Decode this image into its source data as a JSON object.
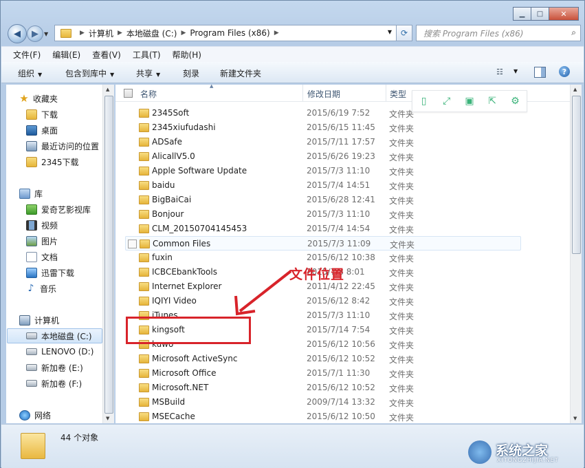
{
  "window": {
    "minimize": "▁",
    "maximize": "□",
    "close": "✕"
  },
  "address": {
    "crumbs": [
      "计算机",
      "本地磁盘 (C:)",
      "Program Files (x86)"
    ],
    "search_placeholder": "搜索 Program Files (x86)"
  },
  "menu": [
    "文件(F)",
    "编辑(E)",
    "查看(V)",
    "工具(T)",
    "帮助(H)"
  ],
  "toolbar": {
    "organize": "组织",
    "include_in_library": "包含到库中",
    "share": "共享",
    "burn": "刻录",
    "new_folder": "新建文件夹"
  },
  "sidebar": {
    "favorites": "收藏夹",
    "favorites_items": [
      "下载",
      "桌面",
      "最近访问的位置",
      "2345下载"
    ],
    "libraries": "库",
    "library_items": [
      "爱奇艺影视库",
      "视频",
      "图片",
      "文档",
      "迅雷下载",
      "音乐"
    ],
    "computer": "计算机",
    "drives": [
      "本地磁盘 (C:)",
      "LENOVO (D:)",
      "新加卷 (E:)",
      "新加卷 (F:)"
    ],
    "network": "网络"
  },
  "columns": {
    "name": "名称",
    "date": "修改日期",
    "type": "类型"
  },
  "files": [
    {
      "name": "2345Soft",
      "date": "2015/6/19 7:52",
      "type": "文件夹"
    },
    {
      "name": "2345xiufudashi",
      "date": "2015/6/15 11:45",
      "type": "文件夹"
    },
    {
      "name": "ADSafe",
      "date": "2015/7/11 17:57",
      "type": "文件夹"
    },
    {
      "name": "AlicallV5.0",
      "date": "2015/6/26 19:23",
      "type": "文件夹"
    },
    {
      "name": "Apple Software Update",
      "date": "2015/7/3 11:10",
      "type": "文件夹"
    },
    {
      "name": "baidu",
      "date": "2015/7/4 14:51",
      "type": "文件夹"
    },
    {
      "name": "BigBaiCai",
      "date": "2015/6/28 12:41",
      "type": "文件夹"
    },
    {
      "name": "Bonjour",
      "date": "2015/7/3 11:10",
      "type": "文件夹"
    },
    {
      "name": "CLM_20150704145453",
      "date": "2015/7/4 14:54",
      "type": "文件夹"
    },
    {
      "name": "Common Files",
      "date": "2015/7/3 11:09",
      "type": "文件夹"
    },
    {
      "name": "fuxin",
      "date": "2015/6/12 10:38",
      "type": "文件夹"
    },
    {
      "name": "ICBCEbankTools",
      "date": "2015/7/8 8:01",
      "type": "文件夹"
    },
    {
      "name": "Internet Explorer",
      "date": "2011/4/12 22:45",
      "type": "文件夹"
    },
    {
      "name": "IQIYI Video",
      "date": "2015/6/12 8:42",
      "type": "文件夹"
    },
    {
      "name": "iTunes",
      "date": "2015/7/3 11:10",
      "type": "文件夹"
    },
    {
      "name": "kingsoft",
      "date": "2015/7/14 7:54",
      "type": "文件夹"
    },
    {
      "name": "kuwo",
      "date": "2015/6/12 10:56",
      "type": "文件夹"
    },
    {
      "name": "Microsoft ActiveSync",
      "date": "2015/6/12 10:52",
      "type": "文件夹"
    },
    {
      "name": "Microsoft Office",
      "date": "2015/7/1 11:30",
      "type": "文件夹"
    },
    {
      "name": "Microsoft.NET",
      "date": "2015/6/12 10:52",
      "type": "文件夹"
    },
    {
      "name": "MSBuild",
      "date": "2009/7/14 13:32",
      "type": "文件夹"
    },
    {
      "name": "MSECache",
      "date": "2015/6/12 10:50",
      "type": "文件夹"
    }
  ],
  "annotation": "文件位置",
  "status": {
    "count": "44 个对象"
  },
  "watermark": {
    "title": "系统之家",
    "url": "XITONGZHIJIA.NET"
  },
  "colors": {
    "accent": "#d8232a",
    "float_icons": "#3bb37a"
  }
}
